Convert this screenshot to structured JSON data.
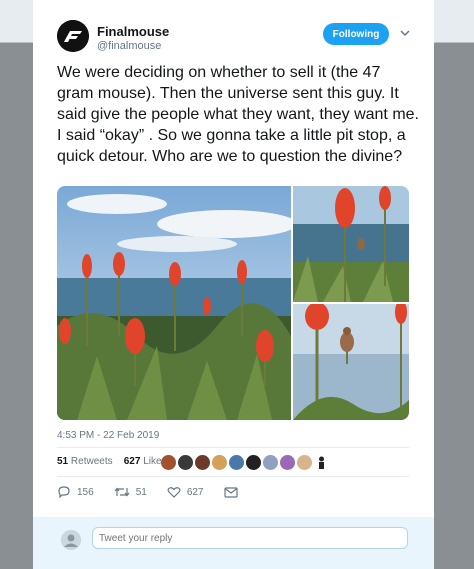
{
  "author": {
    "name": "Finalmouse",
    "handle": "@finalmouse",
    "follow_label": "Following"
  },
  "tweet": {
    "text": "We were deciding on whether to sell it (the 47 gram mouse). Then the universe sent this guy. It said give the people what they want, they want me. I said “okay” . So we gonna take a little pit stop, a quick detour. Who are we to question the divine?",
    "timestamp": "4:53 PM - 22 Feb 2019"
  },
  "stats": {
    "retweets_count": "51",
    "retweets_label": "Retweets",
    "likes_count": "627",
    "likes_label": "Likes"
  },
  "actions": {
    "reply_count": "156",
    "retweet_count": "51",
    "like_count": "627"
  },
  "reply": {
    "placeholder": "Tweet your reply"
  },
  "colors": {
    "accent": "#1da1f2",
    "muted": "#657786"
  },
  "icons": [
    "finalmouse-logo-icon",
    "chevron-down-icon",
    "reply-icon",
    "retweet-icon",
    "heart-icon",
    "envelope-icon"
  ]
}
